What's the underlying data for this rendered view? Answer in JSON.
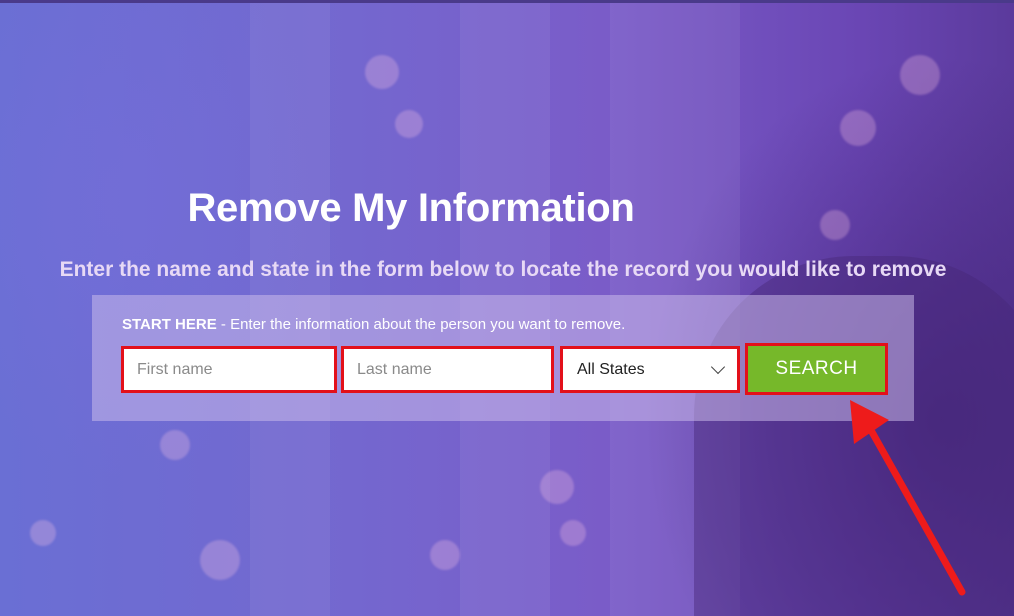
{
  "hero": {
    "title": "Remove My Information",
    "subtitle": "Enter the name and state in the form below to locate the record you would like to remove"
  },
  "form": {
    "instruction_bold": "START HERE",
    "instruction_text": " - Enter the information about the person you want to remove.",
    "first_name": {
      "placeholder": "First name",
      "value": ""
    },
    "last_name": {
      "placeholder": "Last name",
      "value": ""
    },
    "state": {
      "selected": "All States"
    },
    "search_label": "SEARCH"
  },
  "colors": {
    "accent_green": "#76b82a",
    "highlight_red": "#e3101a"
  }
}
